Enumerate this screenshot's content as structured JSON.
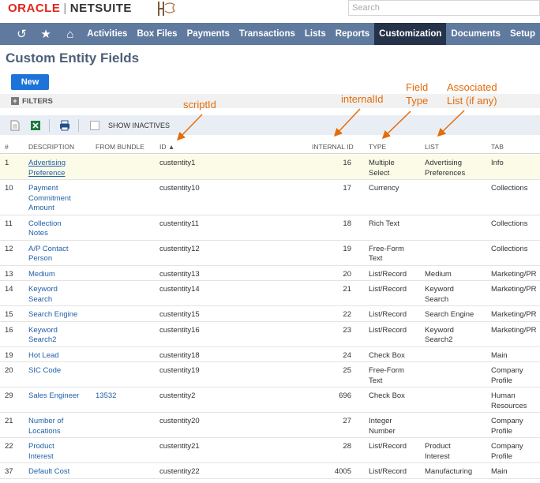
{
  "brand": {
    "oracle": "ORACLE",
    "sep": "|",
    "netsuite": "NETSUITE"
  },
  "search": {
    "placeholder": "Search"
  },
  "nav": {
    "icons": [
      "recent-icon",
      "star-icon",
      "home-icon"
    ],
    "items": [
      "Activities",
      "Box Files",
      "Payments",
      "Transactions",
      "Lists",
      "Reports",
      "Customization",
      "Documents",
      "Setup"
    ],
    "active": "Customization"
  },
  "page": {
    "title": "Custom Entity Fields",
    "new_label": "New",
    "filters_label": "FILTERS",
    "show_inactives": "SHOW INACTIVES"
  },
  "table": {
    "headers": {
      "num": "#",
      "description": "DESCRIPTION",
      "bundle": "FROM BUNDLE",
      "id": "ID ▲",
      "internal_id": "INTERNAL ID",
      "type": "TYPE",
      "list": "LIST",
      "tab": "TAB"
    },
    "rows": [
      {
        "num": "1",
        "desc": [
          "Advertising",
          "Preference"
        ],
        "bundle": "",
        "id": "custentity1",
        "iid": "16",
        "type": [
          "Multiple",
          "Select"
        ],
        "list": [
          "Advertising",
          "Preferences"
        ],
        "tab": [
          "Info"
        ]
      },
      {
        "num": "10",
        "desc": [
          "Payment",
          "Commitment",
          "Amount"
        ],
        "bundle": "",
        "id": "custentity10",
        "iid": "17",
        "type": [
          "Currency"
        ],
        "list": [],
        "tab": [
          "Collections"
        ]
      },
      {
        "num": "11",
        "desc": [
          "Collection",
          "Notes"
        ],
        "bundle": "",
        "id": "custentity11",
        "iid": "18",
        "type": [
          "Rich Text"
        ],
        "list": [],
        "tab": [
          "Collections"
        ]
      },
      {
        "num": "12",
        "desc": [
          "A/P Contact",
          "Person"
        ],
        "bundle": "",
        "id": "custentity12",
        "iid": "19",
        "type": [
          "Free-Form",
          "Text"
        ],
        "list": [],
        "tab": [
          "Collections"
        ]
      },
      {
        "num": "13",
        "desc": [
          "Medium"
        ],
        "bundle": "",
        "id": "custentity13",
        "iid": "20",
        "type": [
          "List/Record"
        ],
        "list": [
          "Medium"
        ],
        "tab": [
          "Marketing/PR"
        ]
      },
      {
        "num": "14",
        "desc": [
          "Keyword",
          "Search"
        ],
        "bundle": "",
        "id": "custentity14",
        "iid": "21",
        "type": [
          "List/Record"
        ],
        "list": [
          "Keyword",
          "Search"
        ],
        "tab": [
          "Marketing/PR"
        ]
      },
      {
        "num": "15",
        "desc": [
          "Search Engine"
        ],
        "bundle": "",
        "id": "custentity15",
        "iid": "22",
        "type": [
          "List/Record"
        ],
        "list": [
          "Search Engine"
        ],
        "tab": [
          "Marketing/PR"
        ]
      },
      {
        "num": "16",
        "desc": [
          "Keyword",
          "Search2"
        ],
        "bundle": "",
        "id": "custentity16",
        "iid": "23",
        "type": [
          "List/Record"
        ],
        "list": [
          "Keyword",
          "Search2"
        ],
        "tab": [
          "Marketing/PR"
        ]
      },
      {
        "num": "19",
        "desc": [
          "Hot Lead"
        ],
        "bundle": "",
        "id": "custentity18",
        "iid": "24",
        "type": [
          "Check Box"
        ],
        "list": [],
        "tab": [
          "Main"
        ]
      },
      {
        "num": "20",
        "desc": [
          "SIC Code"
        ],
        "bundle": "",
        "id": "custentity19",
        "iid": "25",
        "type": [
          "Free-Form",
          "Text"
        ],
        "list": [],
        "tab": [
          "Company",
          "Profile"
        ]
      },
      {
        "num": "29",
        "desc": [
          "Sales Engineer"
        ],
        "bundle": "13532",
        "id": "custentity2",
        "iid": "696",
        "type": [
          "Check Box"
        ],
        "list": [],
        "tab": [
          "Human",
          "Resources"
        ]
      },
      {
        "num": "21",
        "desc": [
          "Number of",
          "Locations"
        ],
        "bundle": "",
        "id": "custentity20",
        "iid": "27",
        "type": [
          "Integer",
          "Number"
        ],
        "list": [],
        "tab": [
          "Company",
          "Profile"
        ]
      },
      {
        "num": "22",
        "desc": [
          "Product",
          "Interest"
        ],
        "bundle": "",
        "id": "custentity21",
        "iid": "28",
        "type": [
          "List/Record"
        ],
        "list": [
          "Product",
          "Interest"
        ],
        "tab": [
          "Company",
          "Profile"
        ]
      },
      {
        "num": "37",
        "desc": [
          "Default Cost"
        ],
        "bundle": "",
        "id": "custentity22",
        "iid": "4005",
        "type": [
          "List/Record"
        ],
        "list": [
          "Manufacturing"
        ],
        "tab": [
          "Main"
        ]
      }
    ]
  },
  "annotations": {
    "script_id": "scriptId",
    "internal_id": "internalId",
    "field_type": [
      "Field",
      "Type"
    ],
    "associated_list": [
      "Associated",
      "List (if any)"
    ],
    "color": "#e46c0a"
  },
  "colors": {
    "nav_bg": "#5f7a9e",
    "nav_active": "#25334a",
    "new_button": "#1c74d9",
    "link": "#1f5fa8",
    "oracle_red": "#e1261c"
  }
}
